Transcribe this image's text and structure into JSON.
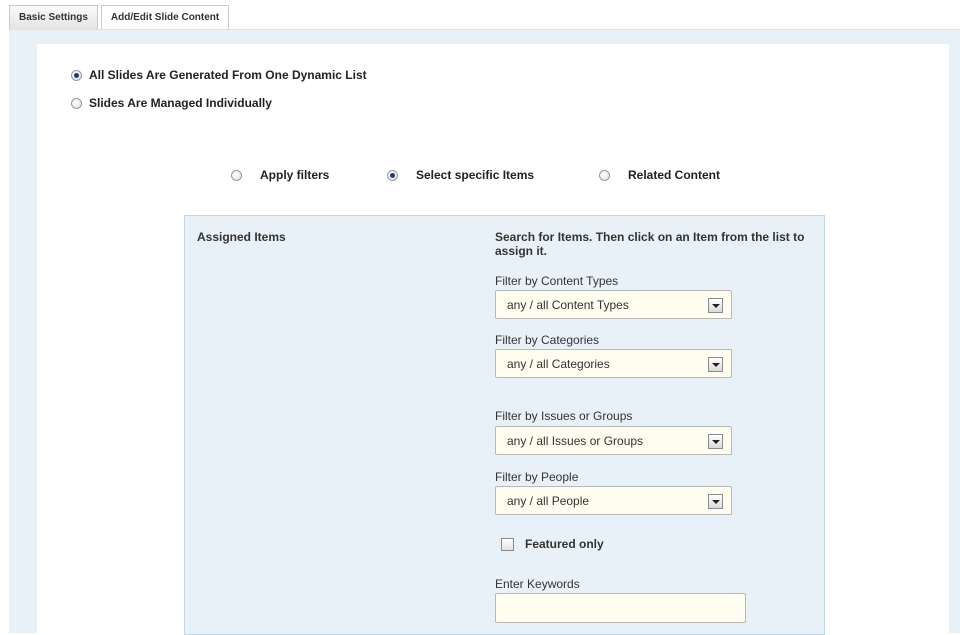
{
  "tabs": [
    {
      "label": "Basic Settings",
      "active": false
    },
    {
      "label": "Add/Edit Slide Content",
      "active": true
    }
  ],
  "slide_mode": {
    "options": [
      {
        "label": "All Slides Are Generated From One Dynamic List",
        "checked": true
      },
      {
        "label": "Slides Are Managed Individually",
        "checked": false
      }
    ]
  },
  "content_source": {
    "options": [
      {
        "label": "Apply filters",
        "checked": false
      },
      {
        "label": "Select specific Items",
        "checked": true
      },
      {
        "label": "Related Content",
        "checked": false
      }
    ]
  },
  "assigned": {
    "title": "Assigned Items"
  },
  "search": {
    "title": "Search for Items. Then click on an Item from the list to assign it.",
    "filters": [
      {
        "label": "Filter by Content Types",
        "value": "any / all Content Types"
      },
      {
        "label": "Filter by Categories",
        "value": "any / all Categories"
      },
      {
        "label": "Filter by Issues or Groups",
        "value": "any / all Issues or Groups"
      },
      {
        "label": "Filter by People",
        "value": "any / all People"
      }
    ],
    "featured_label": "Featured only",
    "featured_checked": false,
    "keywords_label": "Enter Keywords",
    "keywords_value": ""
  },
  "colors": {
    "background_panel": "#e8f1f7",
    "select_background": "#fffdef",
    "radio_dot": "#1f3a7a"
  }
}
